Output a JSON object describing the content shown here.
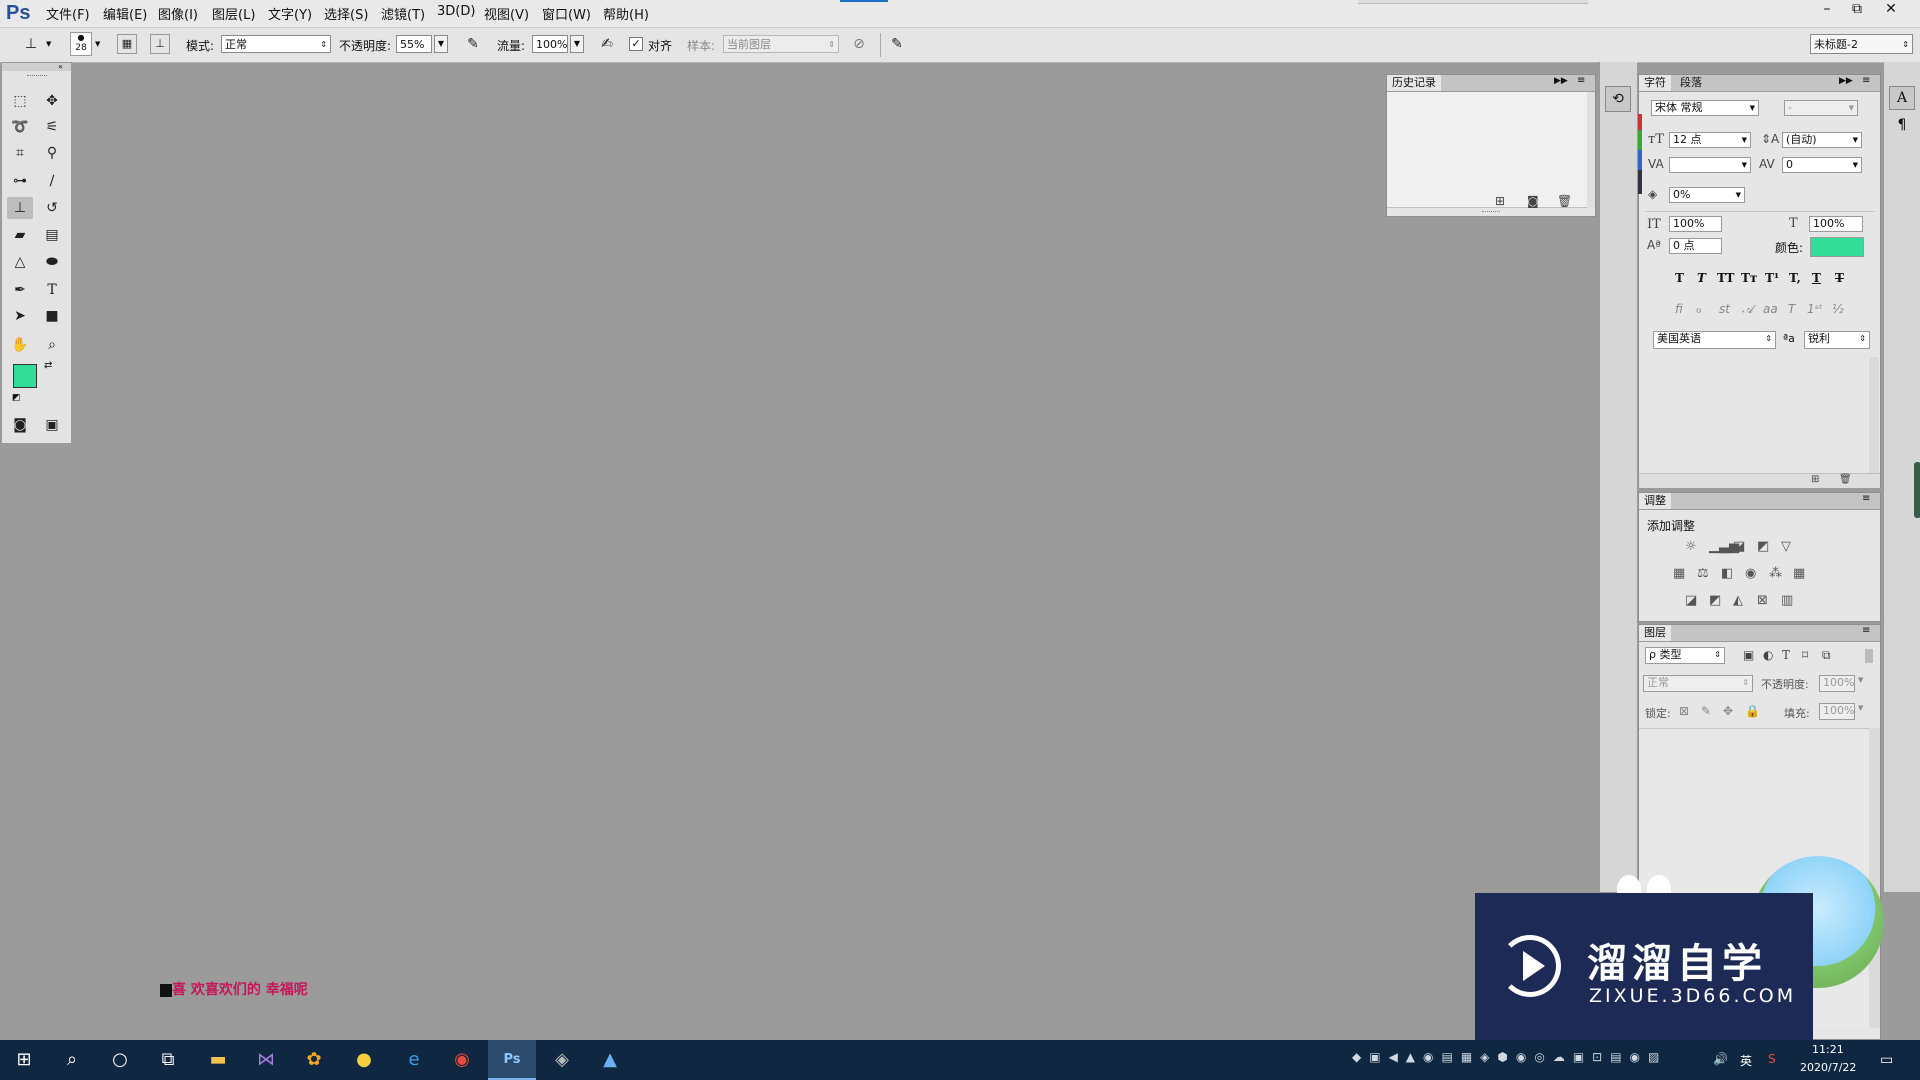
{
  "app": {
    "logo": "Ps"
  },
  "menu": [
    "文件(F)",
    "编辑(E)",
    "图像(I)",
    "图层(L)",
    "文字(Y)",
    "选择(S)",
    "滤镜(T)",
    "3D(D)",
    "视图(V)",
    "窗口(W)",
    "帮助(H)"
  ],
  "options": {
    "brush_size": "28",
    "mode_label": "模式:",
    "mode_value": "正常",
    "opacity_label": "不透明度:",
    "opacity_value": "55%",
    "flow_label": "流量:",
    "flow_value": "100%",
    "align_label": "对齐",
    "align_checked": true,
    "sample_label": "样本:",
    "sample_value": "当前图层",
    "workspace": "未标题-2"
  },
  "tools": {
    "foreground_color": "#33dd99",
    "background_color": "#ffffff"
  },
  "history_panel": {
    "tab": "历史记录"
  },
  "character_panel": {
    "tabs": [
      "字符",
      "段落"
    ],
    "font_family": "宋体 常规",
    "font_style": "-",
    "font_size": "12 点",
    "leading": "(自动)",
    "kerning": "",
    "tracking": "0",
    "tsume": "0%",
    "vscale": "100%",
    "hscale": "100%",
    "baseline": "0 点",
    "color_label": "颜色:",
    "color": "#33dd99",
    "language": "美国英语",
    "aa_label": "ªa",
    "antialias": "锐利"
  },
  "adjust_panel": {
    "tab": "调整",
    "title": "添加调整"
  },
  "layers_panel": {
    "tab": "图层",
    "filter": "ρ 类型",
    "blend": "正常",
    "opacity_label": "不透明度:",
    "opacity": "100%",
    "lock_label": "锁定:",
    "fill_label": "填充:",
    "fill": "100%"
  },
  "canvas_text": "喜 欢喜欢们的 幸福呢",
  "watermark": {
    "title": "溜溜自学",
    "url": "ZIXUE.3D66.COM"
  },
  "taskbar": {
    "time": "11:21",
    "date": "2020/7/22",
    "ime": "英"
  }
}
